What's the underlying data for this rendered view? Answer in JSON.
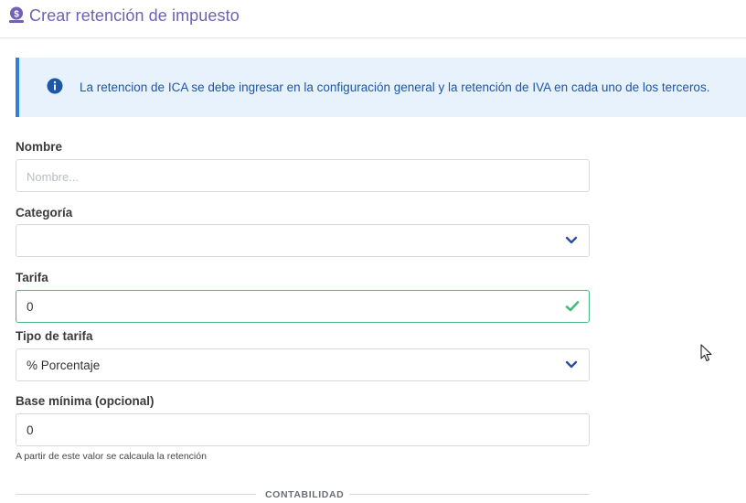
{
  "header": {
    "title": "Crear retención de impuesto",
    "icon": "money-bag-icon",
    "title_color": "#7160b8"
  },
  "alert": {
    "icon": "info-circle-icon",
    "text": "La retencion de ICA se debe ingresar en la configuración general y la retención de IVA en cada uno de los terceros.",
    "color": "#2f80d8"
  },
  "form": {
    "nombre": {
      "label": "Nombre",
      "placeholder": "Nombre...",
      "value": ""
    },
    "categoria": {
      "label": "Categoría",
      "value": "",
      "icon": "chevron-down-icon"
    },
    "tarifa": {
      "label": "Tarifa",
      "value": "0",
      "icon": "checkmark-icon",
      "valid_color": "#47b881"
    },
    "tipo_tarifa": {
      "label": "Tipo de tarifa",
      "value": "% Porcentaje",
      "icon": "chevron-down-icon"
    },
    "base_minima": {
      "label": "Base mínima (opcional)",
      "value": "0",
      "help": "A partir de este valor se calcaula la retención"
    }
  },
  "section": {
    "divider_label": "CONTABILIDAD"
  }
}
